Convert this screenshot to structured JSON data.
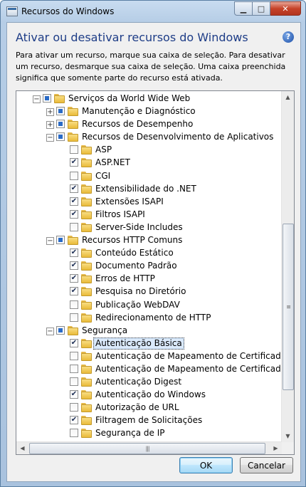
{
  "window": {
    "title": "Recursos do Windows",
    "buttons": {
      "minimize": "▁",
      "maximize": "□",
      "close": "✕"
    }
  },
  "heading": "Ativar ou desativar recursos do Windows",
  "help": "?",
  "description": "Para ativar um recurso, marque sua caixa de seleção. Para desativar um recurso, desmarque sua caixa de seleção. Uma caixa preenchida significa que somente parte do recurso está ativada.",
  "tree": [
    {
      "level": 0,
      "expander": "−",
      "check": "partial",
      "label": "Serviços da World Wide Web"
    },
    {
      "level": 1,
      "expander": "+",
      "check": "partial",
      "label": "Manutenção e Diagnóstico"
    },
    {
      "level": 1,
      "expander": "+",
      "check": "partial",
      "label": "Recursos de Desempenho"
    },
    {
      "level": 1,
      "expander": "−",
      "check": "partial",
      "label": "Recursos de Desenvolvimento de Aplicativos"
    },
    {
      "level": 2,
      "expander": "",
      "check": "unchecked",
      "label": "ASP"
    },
    {
      "level": 2,
      "expander": "",
      "check": "checked",
      "label": "ASP.NET"
    },
    {
      "level": 2,
      "expander": "",
      "check": "unchecked",
      "label": "CGI"
    },
    {
      "level": 2,
      "expander": "",
      "check": "checked",
      "label": "Extensibilidade do .NET"
    },
    {
      "level": 2,
      "expander": "",
      "check": "checked",
      "label": "Extensões ISAPI"
    },
    {
      "level": 2,
      "expander": "",
      "check": "checked",
      "label": "Filtros ISAPI"
    },
    {
      "level": 2,
      "expander": "",
      "check": "unchecked",
      "label": "Server-Side Includes"
    },
    {
      "level": 1,
      "expander": "−",
      "check": "partial",
      "label": "Recursos HTTP Comuns"
    },
    {
      "level": 2,
      "expander": "",
      "check": "checked",
      "label": "Conteúdo Estático"
    },
    {
      "level": 2,
      "expander": "",
      "check": "checked",
      "label": "Documento Padrão"
    },
    {
      "level": 2,
      "expander": "",
      "check": "checked",
      "label": "Erros de HTTP"
    },
    {
      "level": 2,
      "expander": "",
      "check": "checked",
      "label": "Pesquisa no Diretório"
    },
    {
      "level": 2,
      "expander": "",
      "check": "unchecked",
      "label": "Publicação WebDAV"
    },
    {
      "level": 2,
      "expander": "",
      "check": "unchecked",
      "label": "Redirecionamento de HTTP"
    },
    {
      "level": 1,
      "expander": "−",
      "check": "partial",
      "label": "Segurança"
    },
    {
      "level": 2,
      "expander": "",
      "check": "checked",
      "label": "Autenticação Básica",
      "selected": true
    },
    {
      "level": 2,
      "expander": "",
      "check": "unchecked",
      "label": "Autenticação de Mapeamento de Certificado de C"
    },
    {
      "level": 2,
      "expander": "",
      "check": "unchecked",
      "label": "Autenticação de Mapeamento de Certificado de C"
    },
    {
      "level": 2,
      "expander": "",
      "check": "unchecked",
      "label": "Autenticação Digest"
    },
    {
      "level": 2,
      "expander": "",
      "check": "checked",
      "label": "Autenticação do Windows"
    },
    {
      "level": 2,
      "expander": "",
      "check": "unchecked",
      "label": "Autorização de URL"
    },
    {
      "level": 2,
      "expander": "",
      "check": "checked",
      "label": "Filtragem de Solicitações"
    },
    {
      "level": 2,
      "expander": "",
      "check": "unchecked",
      "label": "Segurança de IP"
    }
  ],
  "scrollbar": {
    "up": "▲",
    "down": "▼",
    "left": "◀",
    "right": "▶",
    "grip": "≡",
    "hgrip": "|||"
  },
  "ok_label": "OK",
  "cancel_label": "Cancelar"
}
